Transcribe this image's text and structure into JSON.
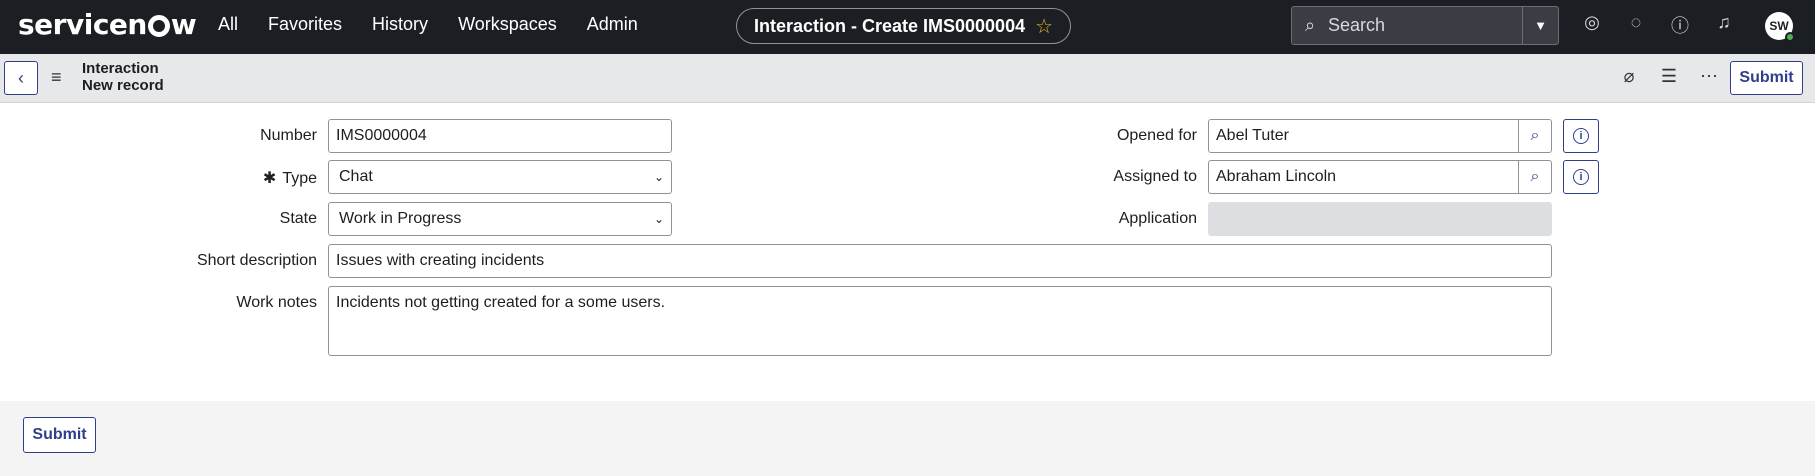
{
  "brand": {
    "logo_text_a": "servicen",
    "logo_text_b": "w"
  },
  "nav": {
    "items": [
      "All",
      "Favorites",
      "History",
      "Workspaces",
      "Admin"
    ]
  },
  "title_pill": {
    "text": "Interaction - Create IMS0000004"
  },
  "search": {
    "placeholder": "Search"
  },
  "user": {
    "initials": "SW"
  },
  "header": {
    "breadcrumb_1": "Interaction",
    "breadcrumb_2": "New record",
    "submit_label": "Submit"
  },
  "form": {
    "number": {
      "label": "Number",
      "value": "IMS0000004"
    },
    "type": {
      "label": "Type",
      "required_marker": "✱",
      "value": "Chat"
    },
    "state": {
      "label": "State",
      "value": "Work in Progress"
    },
    "short_description": {
      "label": "Short description",
      "value": "Issues with creating incidents"
    },
    "work_notes": {
      "label": "Work notes",
      "value": "Incidents not getting created for a some users."
    },
    "opened_for": {
      "label": "Opened for",
      "value": "Abel Tuter"
    },
    "assigned_to": {
      "label": "Assigned to",
      "value": "Abraham Lincoln"
    },
    "application": {
      "label": "Application",
      "value": ""
    }
  },
  "footer": {
    "submit_label": "Submit"
  },
  "colors": {
    "nav_bg": "#1b1f24",
    "accent": "#2e3f8c",
    "star": "#e8b52a"
  }
}
